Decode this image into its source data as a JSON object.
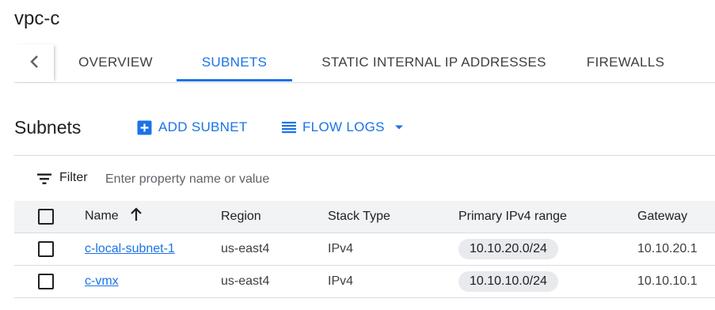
{
  "page": {
    "title": "vpc-c"
  },
  "tabs": [
    {
      "label": "OVERVIEW",
      "active": false
    },
    {
      "label": "SUBNETS",
      "active": true
    },
    {
      "label": "STATIC INTERNAL IP ADDRESSES",
      "active": false
    },
    {
      "label": "FIREWALLS",
      "active": false
    }
  ],
  "section": {
    "title": "Subnets"
  },
  "actions": {
    "add_subnet": "ADD SUBNET",
    "flow_logs": "FLOW LOGS"
  },
  "filter": {
    "label": "Filter",
    "placeholder": "Enter property name or value"
  },
  "table": {
    "columns": [
      "Name",
      "Region",
      "Stack Type",
      "Primary IPv4 range",
      "Gateway"
    ],
    "sort": {
      "column": "Name",
      "direction": "ascending"
    },
    "rows": [
      {
        "name": "c-local-subnet-1",
        "region": "us-east4",
        "stack_type": "IPv4",
        "range": "10.10.20.0/24",
        "gateway": "10.10.20.1"
      },
      {
        "name": "c-vmx",
        "region": "us-east4",
        "stack_type": "IPv4",
        "range": "10.10.10.0/24",
        "gateway": "10.10.10.1"
      }
    ]
  },
  "colors": {
    "accent": "#1a73e8",
    "text": "#202124",
    "chip_bg": "#e8eaed",
    "divider": "#dadce0"
  },
  "icons": [
    "chevron-left-icon",
    "add-box-icon",
    "list-icon",
    "dropdown-arrow-icon",
    "filter-icon",
    "arrow-up-icon"
  ]
}
